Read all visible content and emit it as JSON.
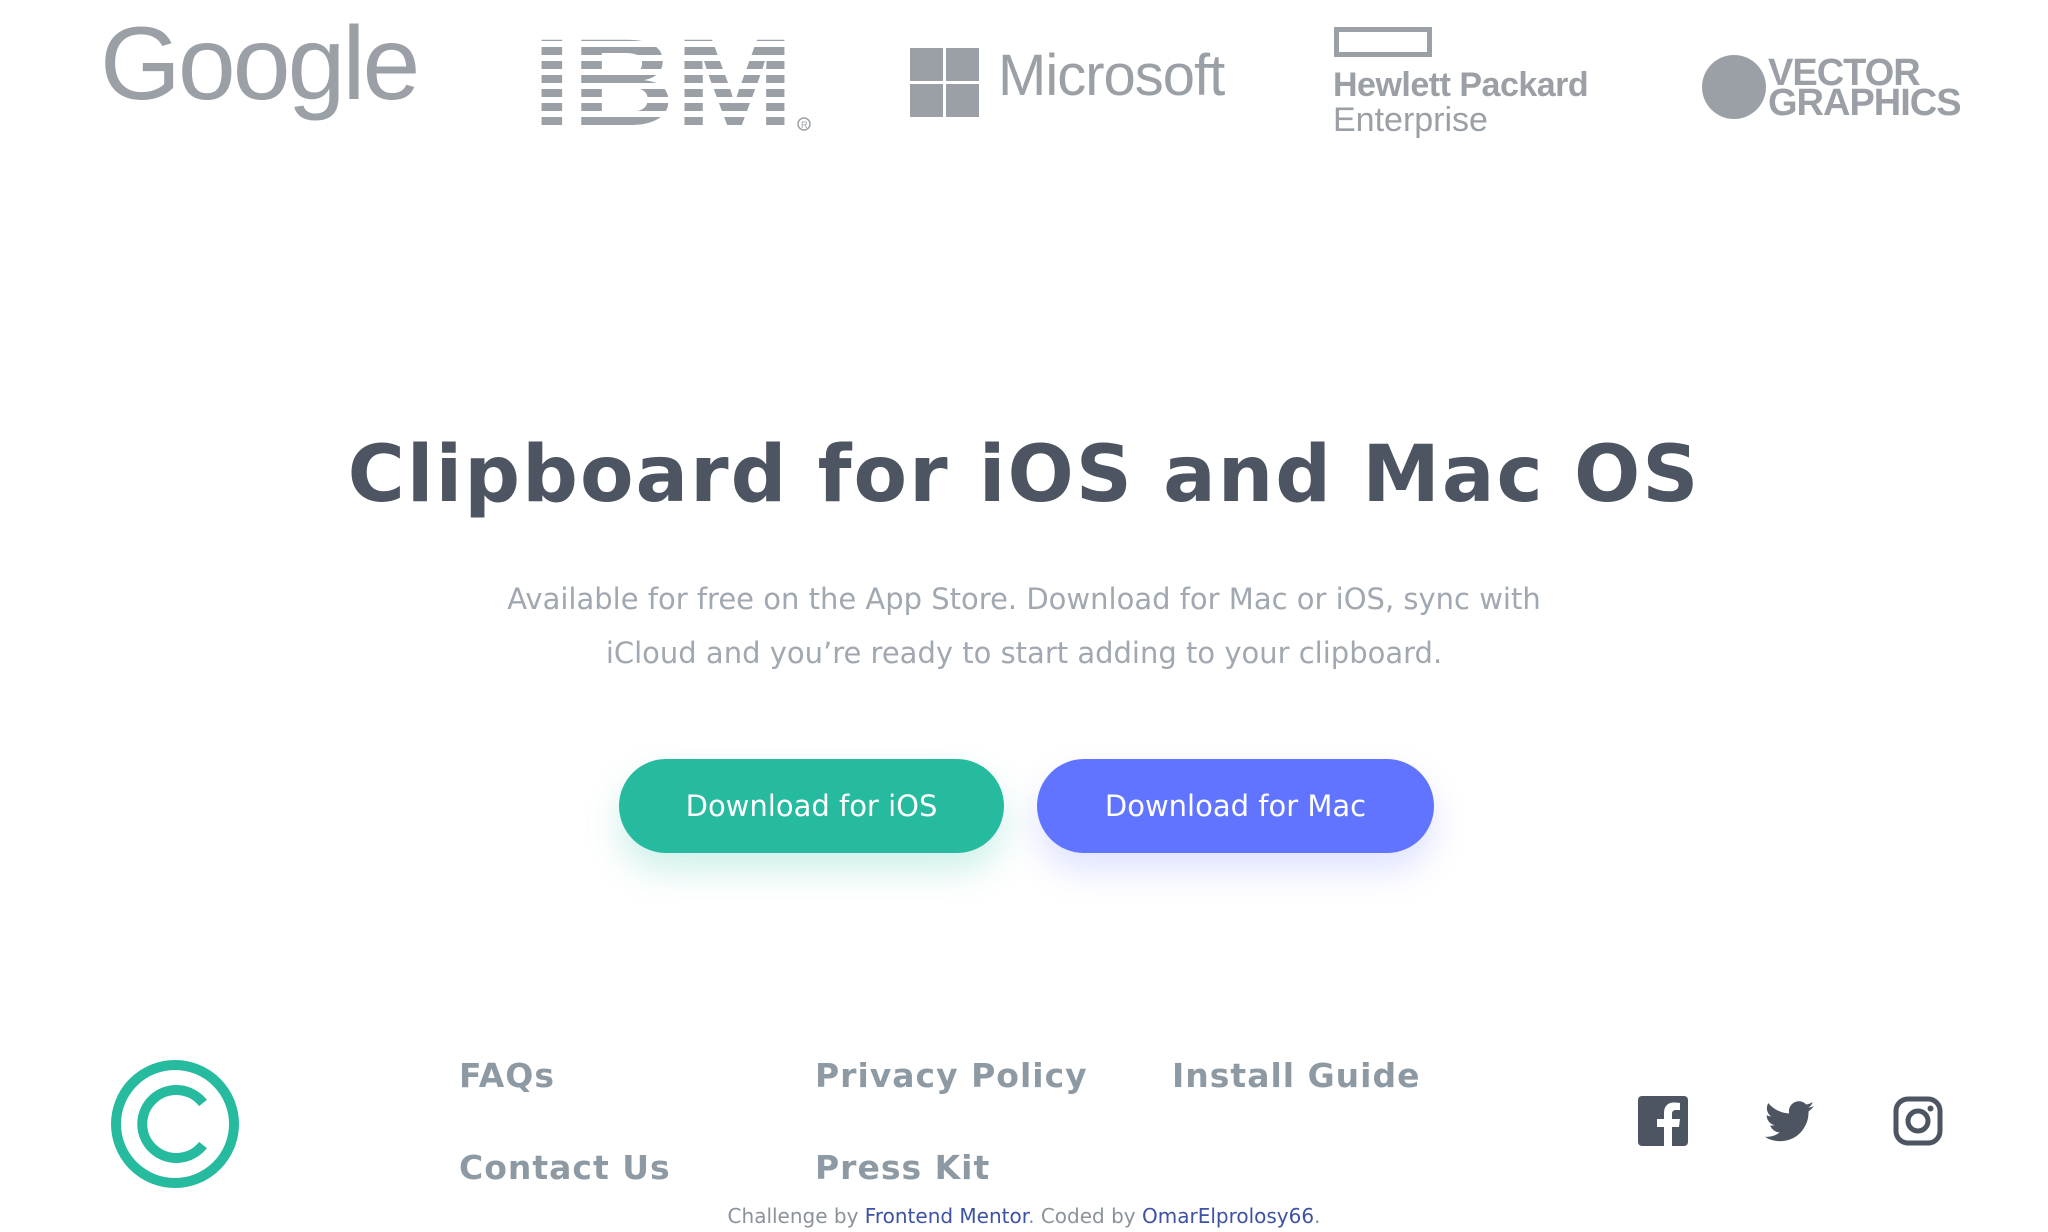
{
  "logos": {
    "google": "Google",
    "ibm": "IBM",
    "microsoft": "Microsoft",
    "hpe_line1": "Hewlett Packard",
    "hpe_line2": "Enterprise",
    "vector_line1": "VECTOR",
    "vector_line2": "GRAPHICS",
    "color": "#9aa0a6"
  },
  "cta": {
    "title": "Clipboard for iOS and Mac OS",
    "description": "Available for free on the App Store. Download for Mac or iOS, sync with iCloud and you’re ready to start adding to your clipboard.",
    "ios_button": "Download for iOS",
    "mac_button": "Download for Mac",
    "ios_color": "#26ba9f",
    "mac_color": "#6174ff"
  },
  "footer": {
    "links": {
      "faqs": "FAQs",
      "privacy": "Privacy Policy",
      "install": "Install Guide",
      "contact": "Contact Us",
      "press": "Press Kit"
    },
    "social": [
      "facebook-icon",
      "twitter-icon",
      "instagram-icon"
    ],
    "attribution": {
      "prefix": "Challenge by ",
      "challenge_link": "Frontend Mentor",
      "middle": ". Coded by ",
      "author_link": "OmarElprolosy66",
      "suffix": "."
    },
    "brand_color": "#26ba9f"
  }
}
